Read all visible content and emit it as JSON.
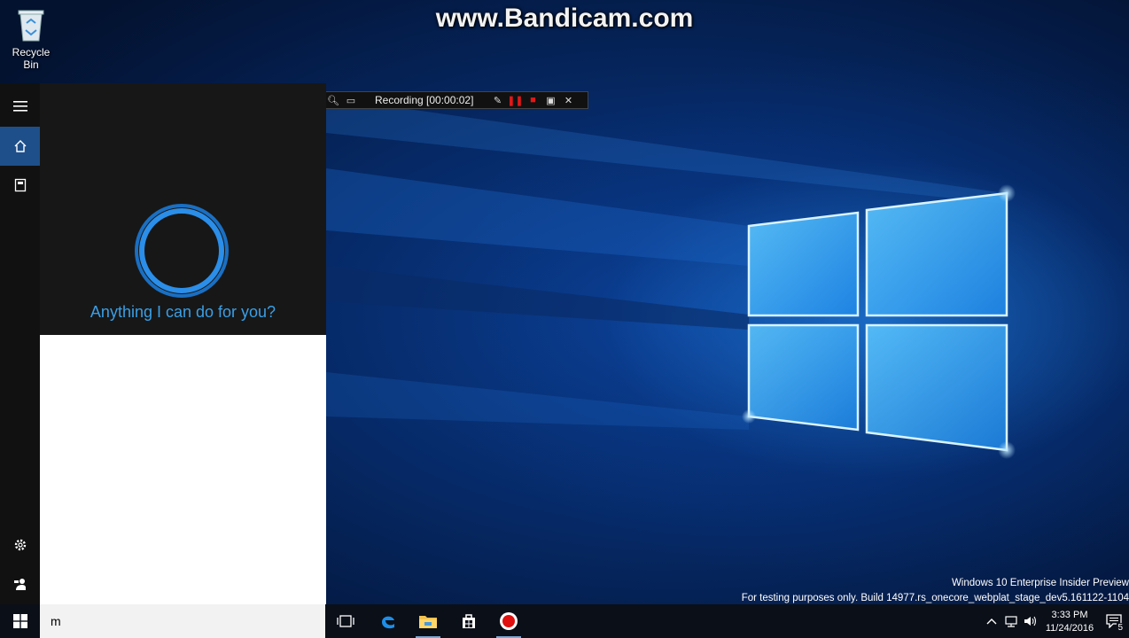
{
  "watermark": "www.Bandicam.com",
  "desktop": {
    "icons": [
      {
        "label": "Recycle Bin",
        "icon": "recycle-bin-icon"
      }
    ]
  },
  "recorder_toolbar": {
    "status": "Recording [00:00:02]"
  },
  "cortana": {
    "rail": [
      {
        "name": "menu",
        "icon": "hamburger-icon"
      },
      {
        "name": "home",
        "icon": "home-icon",
        "active": true
      },
      {
        "name": "notebook",
        "icon": "notebook-icon"
      },
      {
        "name": "settings",
        "icon": "gear-icon"
      },
      {
        "name": "feedback",
        "icon": "feedback-icon"
      }
    ],
    "prompt": "Anything I can do for you?",
    "accent": "#3a9fe6"
  },
  "taskbar": {
    "search_value": "m",
    "apps": [
      {
        "name": "task-view",
        "icon": "task-view-icon"
      },
      {
        "name": "edge",
        "icon": "edge-icon"
      },
      {
        "name": "file-explorer",
        "icon": "folder-icon",
        "running": true
      },
      {
        "name": "store",
        "icon": "store-icon"
      },
      {
        "name": "bandicam",
        "icon": "bandicam-icon",
        "running": true
      }
    ],
    "clock": {
      "time": "3:33 PM",
      "date": "11/24/2016"
    },
    "notifications": "5"
  },
  "windows_info": {
    "line1": "Windows 10 Enterprise Insider Preview",
    "line2": "For testing purposes only. Build 14977.rs_onecore_webplat_stage_dev5.161122-1104"
  }
}
